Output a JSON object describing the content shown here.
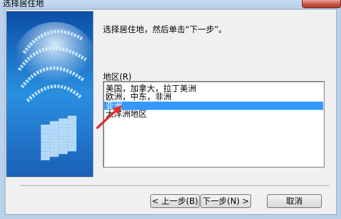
{
  "window": {
    "title": "选择居住地"
  },
  "dialog": {
    "instruction": "选择居住地，然后单击“下一步”。",
    "region_label": "地区(R)",
    "regions": [
      {
        "label": "美国，加拿大，拉丁美洲",
        "selected": false
      },
      {
        "label": "欧洲，中东，非洲",
        "selected": false
      },
      {
        "label": "亚洲",
        "selected": true
      },
      {
        "label": "大洋洲地区",
        "selected": false
      }
    ]
  },
  "buttons": {
    "back": "< 上一步(B)",
    "next": "下一步(N) >",
    "cancel": "取消"
  },
  "colors": {
    "selection": "#3399ff",
    "arrow": "#e03030",
    "banner": "#1f6fc0"
  },
  "icons": {
    "close": "close-icon",
    "pointer_arrow": "arrow-icon",
    "banner_art": "data-cube-illustration"
  }
}
